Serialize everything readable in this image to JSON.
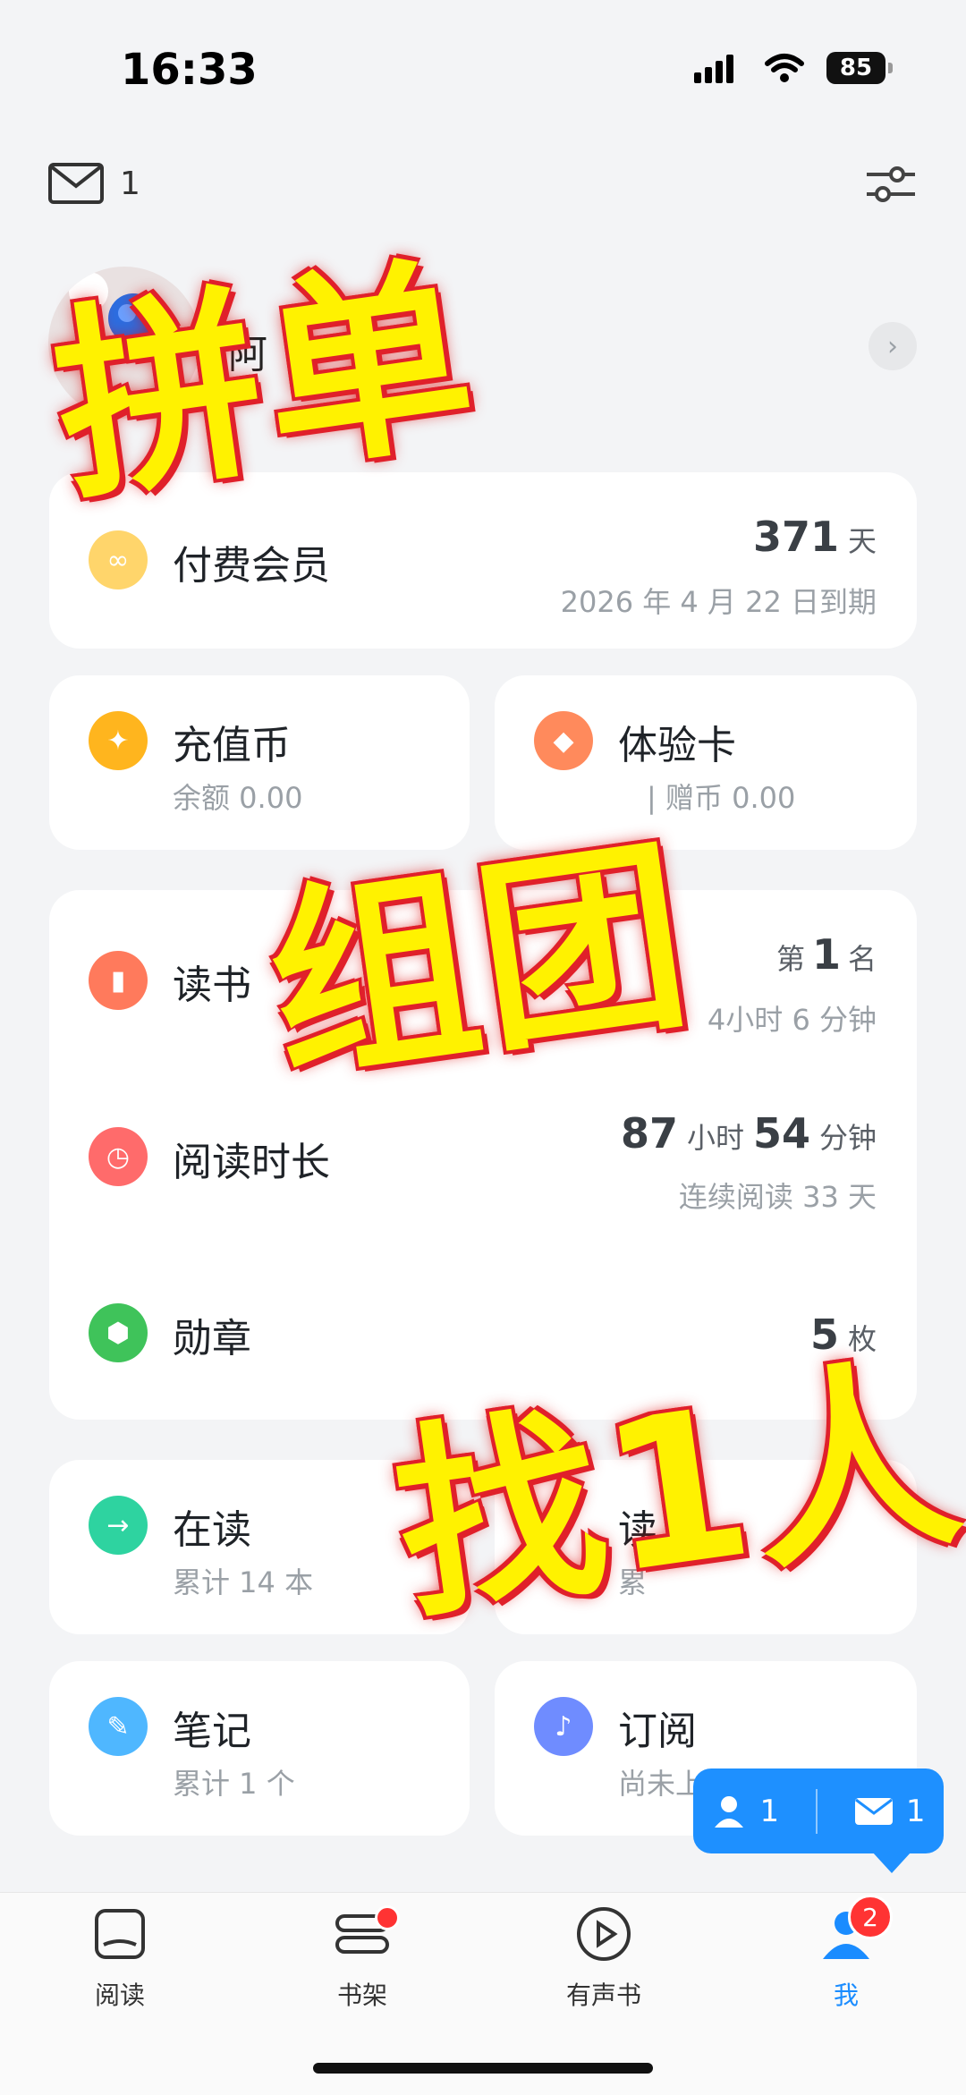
{
  "status": {
    "time": "16:33",
    "battery": "85"
  },
  "top": {
    "mail_count": "1"
  },
  "profile": {
    "name": "阿"
  },
  "membership": {
    "title": "付费会员",
    "days": "371",
    "days_unit": "天",
    "expiry": "2026 年 4 月 22 日到期"
  },
  "recharge": {
    "title": "充值币",
    "sub": "余额 0.00"
  },
  "trial": {
    "title": "体验卡",
    "sub": "| 赠币 0.00"
  },
  "ranking": {
    "title": "读书",
    "rank_prefix": "第",
    "rank": "1",
    "rank_suffix": "名",
    "sub": "4小时 6 分钟"
  },
  "duration": {
    "title": "阅读时长",
    "hours": "87",
    "hours_unit": "小时",
    "minutes": "54",
    "minutes_unit": "分钟",
    "sub": "连续阅读 33 天"
  },
  "medals": {
    "title": "勋章",
    "count": "5",
    "unit": "枚"
  },
  "reading": {
    "title": "在读",
    "sub": "累计 14 本"
  },
  "read_done": {
    "title": "读",
    "sub": "累"
  },
  "notes": {
    "title": "笔记",
    "sub": "累计 1 个"
  },
  "subscription": {
    "title": "订阅",
    "sub": "尚未上"
  },
  "bubble": {
    "users": "1",
    "mail": "1"
  },
  "nav": [
    {
      "label": "阅读"
    },
    {
      "label": "书架"
    },
    {
      "label": "有声书"
    },
    {
      "label": "我",
      "badge": "2"
    }
  ],
  "overlay": {
    "line1": "拼单",
    "line2": "组团",
    "line3": "找1人"
  },
  "colors": {
    "accent": "#1e90ff",
    "overlay_text": "#fff200",
    "overlay_outline": "#e0202a"
  }
}
